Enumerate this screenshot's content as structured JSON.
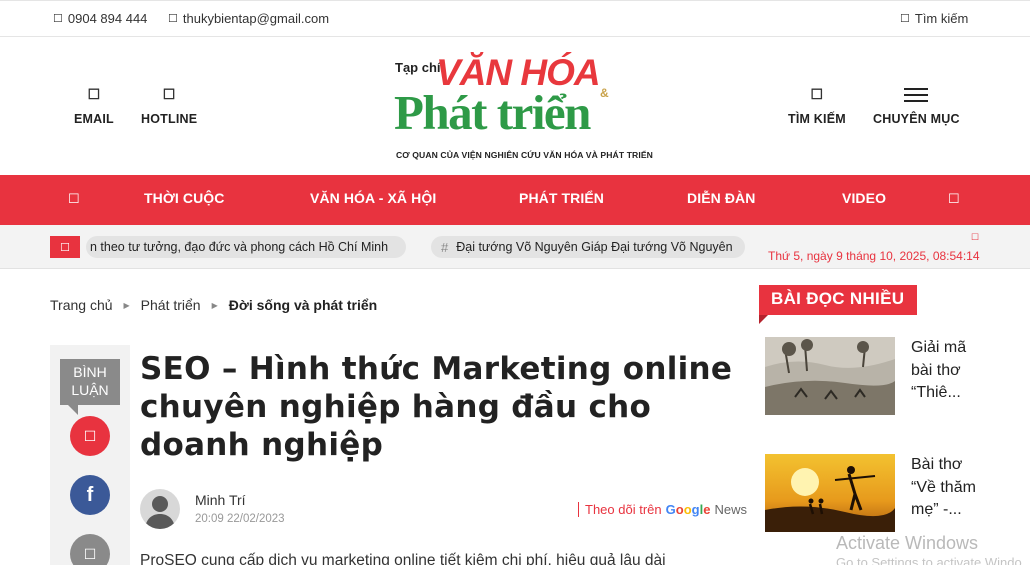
{
  "topbar": {
    "phone": "0904 894 444",
    "email": "thukybientap@gmail.com",
    "search": "Tìm kiếm"
  },
  "header": {
    "email_label": "EMAIL",
    "hotline_label": "HOTLINE",
    "search_label": "TÌM KIẾM",
    "category_label": "CHUYÊN MỤC"
  },
  "logo": {
    "tapchi": "Tạp chí",
    "vanhoa": "VĂN HÓA",
    "amp": "&",
    "phattrien": "Phát triển",
    "subtitle": "CƠ QUAN CỦA VIỆN NGHIÊN CỨU VĂN HÓA VÀ PHÁT TRIỂN"
  },
  "nav": {
    "items": [
      "THỜI CUỘC",
      "VĂN HÓA - XÃ HỘI",
      "PHÁT TRIỂN",
      "DIỄN ĐÀN",
      "VIDEO"
    ]
  },
  "ticker": {
    "item1": "n theo tư tưởng, đạo đức và phong cách Hồ Chí Minh",
    "item2": "Đại tướng Võ Nguyên Giáp Đại tướng Võ Nguyên",
    "date": "Thứ 5, ngày 9 tháng 10, 2025, 08:54:14"
  },
  "breadcrumb": {
    "home": "Trang chủ",
    "section": "Phát triển",
    "current": "Đời sống và phát triển"
  },
  "share": {
    "comment_line1": "BÌNH",
    "comment_line2": "LUẬN"
  },
  "article": {
    "title": "SEO – Hình thức Marketing online chuyên nghiệp hàng đầu cho doanh nghiệp",
    "author": "Minh Trí",
    "date": "20:09 22/02/2023",
    "follow_text": "Theo dõi trên",
    "follow_google": "Google",
    "follow_news": "News",
    "lead": "ProSEO cung cấp dịch vụ marketing online tiết kiệm chi phí, hiệu quả lâu dài"
  },
  "sidebar": {
    "heading": "BÀI ĐỌC NHIỀU",
    "items": [
      {
        "title": "Giải mã bài thơ “Thiê..."
      },
      {
        "title": "Bài thơ “Về thăm mẹ” -..."
      }
    ]
  },
  "watermark": {
    "line1": "Activate Windows",
    "line2": "Go to Settings to activate Windo"
  },
  "colors": {
    "brand_red": "#e8333f",
    "brand_green": "#2e9a47",
    "facebook": "#3b5998"
  }
}
